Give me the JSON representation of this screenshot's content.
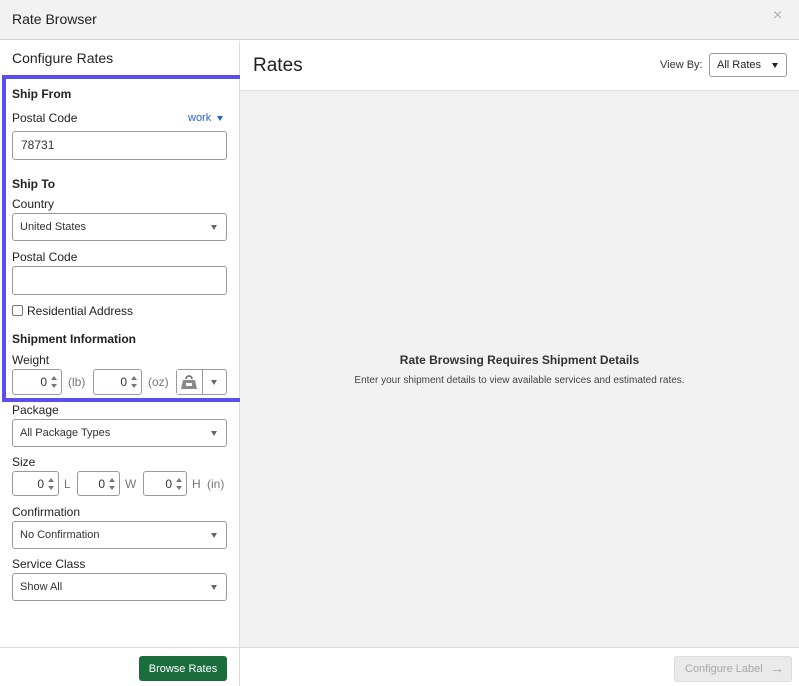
{
  "window": {
    "title": "Rate Browser",
    "close_glyph": "×"
  },
  "left": {
    "heading": "Configure Rates",
    "ship_from": {
      "heading": "Ship From",
      "postal_label": "Postal Code",
      "location_link": "work",
      "postal_value": "78731"
    },
    "ship_to": {
      "heading": "Ship To",
      "country_label": "Country",
      "country_value": "United States",
      "postal_label": "Postal Code",
      "postal_value": "",
      "residential_label": "Residential Address"
    },
    "shipment": {
      "heading": "Shipment Information",
      "weight_label": "Weight",
      "weight_lb": "0",
      "weight_lb_unit": "(lb)",
      "weight_oz": "0",
      "weight_oz_unit": "(oz)",
      "package_label": "Package",
      "package_value": "All Package Types",
      "size_label": "Size",
      "size_l": "0",
      "size_l_unit": "L",
      "size_w": "0",
      "size_w_unit": "W",
      "size_h": "0",
      "size_h_unit": "H",
      "size_in_unit": "(in)",
      "confirmation_label": "Confirmation",
      "confirmation_value": "No Confirmation",
      "service_label": "Service Class",
      "service_value": "Show All"
    },
    "browse_button": "Browse Rates"
  },
  "right": {
    "title": "Rates",
    "view_by_label": "View By:",
    "view_by_value": "All Rates",
    "empty_title": "Rate Browsing Requires Shipment Details",
    "empty_subtitle": "Enter your shipment details to view available services and estimated rates.",
    "configure_label_button": "Configure Label",
    "configure_arrow": "→"
  },
  "icons": {
    "close": "close-icon",
    "link_caret": "caret-down-icon",
    "scale": "scale-icon",
    "select_caret": "chevron-down-icon"
  },
  "colors": {
    "highlight": "#5b4df0",
    "primary": "#1a6e3d",
    "link": "#2563c9"
  }
}
